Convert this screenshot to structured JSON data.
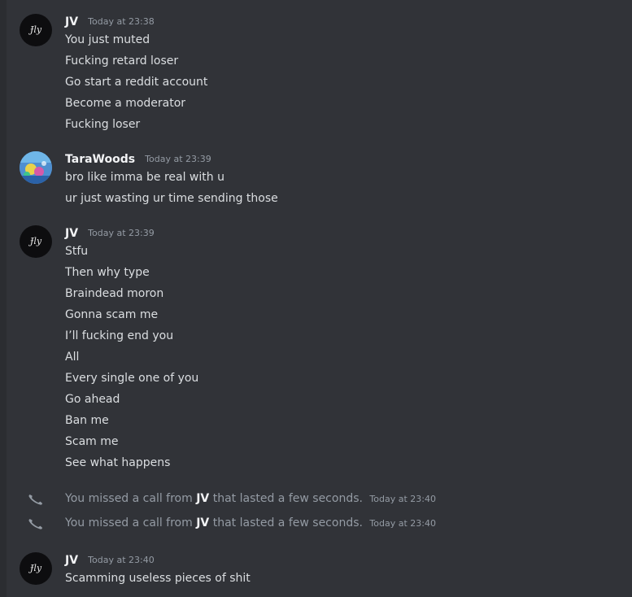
{
  "messages": [
    {
      "author": "JV",
      "timestamp": "Today at 23:38",
      "lines": [
        "You just muted",
        "Fucking retard loser",
        "Go start a reddit account",
        "Become a moderator",
        "Fucking loser"
      ]
    },
    {
      "author": "TaraWoods",
      "timestamp": "Today at 23:39",
      "lines": [
        "bro like imma be real with u",
        "ur just wasting ur time sending those"
      ]
    },
    {
      "author": "JV",
      "timestamp": "Today at 23:39",
      "lines": [
        "Stfu",
        "Then why type",
        "Braindead moron",
        "Gonna scam me",
        "I’ll fucking end you",
        "All",
        "Every single one of you",
        "Go ahead",
        "Ban me",
        "Scam me",
        "See what happens"
      ]
    },
    {
      "author": "JV",
      "timestamp": "Today at 23:40",
      "lines": [
        "Scamming useless pieces of shit"
      ]
    }
  ],
  "calls": [
    {
      "prefix": "You missed a call from",
      "caller": "JV",
      "suffix": "that lasted a few seconds.",
      "timestamp": "Today at 23:40"
    },
    {
      "prefix": "You missed a call from",
      "caller": "JV",
      "suffix": "that lasted a few seconds.",
      "timestamp": "Today at 23:40"
    }
  ],
  "avatar_text": {
    "jv": "Ɉly"
  },
  "colors": {
    "background": "#313338",
    "text": "#dbdee1",
    "muted": "#949ba4",
    "username": "#f2f3f5"
  }
}
